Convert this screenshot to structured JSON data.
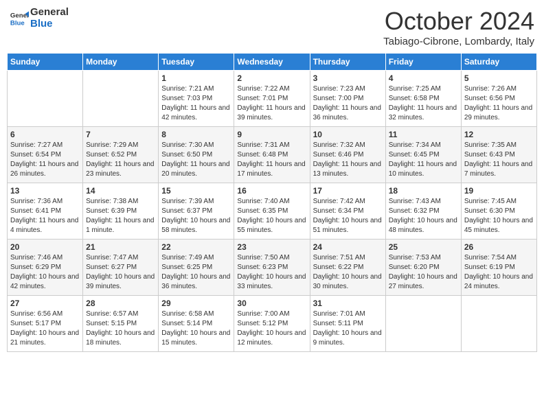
{
  "header": {
    "logo_line1": "General",
    "logo_line2": "Blue",
    "month": "October 2024",
    "location": "Tabiago-Cibrone, Lombardy, Italy"
  },
  "days_of_week": [
    "Sunday",
    "Monday",
    "Tuesday",
    "Wednesday",
    "Thursday",
    "Friday",
    "Saturday"
  ],
  "weeks": [
    [
      {
        "day": "",
        "info": ""
      },
      {
        "day": "",
        "info": ""
      },
      {
        "day": "1",
        "info": "Sunrise: 7:21 AM\nSunset: 7:03 PM\nDaylight: 11 hours and 42 minutes."
      },
      {
        "day": "2",
        "info": "Sunrise: 7:22 AM\nSunset: 7:01 PM\nDaylight: 11 hours and 39 minutes."
      },
      {
        "day": "3",
        "info": "Sunrise: 7:23 AM\nSunset: 7:00 PM\nDaylight: 11 hours and 36 minutes."
      },
      {
        "day": "4",
        "info": "Sunrise: 7:25 AM\nSunset: 6:58 PM\nDaylight: 11 hours and 32 minutes."
      },
      {
        "day": "5",
        "info": "Sunrise: 7:26 AM\nSunset: 6:56 PM\nDaylight: 11 hours and 29 minutes."
      }
    ],
    [
      {
        "day": "6",
        "info": "Sunrise: 7:27 AM\nSunset: 6:54 PM\nDaylight: 11 hours and 26 minutes."
      },
      {
        "day": "7",
        "info": "Sunrise: 7:29 AM\nSunset: 6:52 PM\nDaylight: 11 hours and 23 minutes."
      },
      {
        "day": "8",
        "info": "Sunrise: 7:30 AM\nSunset: 6:50 PM\nDaylight: 11 hours and 20 minutes."
      },
      {
        "day": "9",
        "info": "Sunrise: 7:31 AM\nSunset: 6:48 PM\nDaylight: 11 hours and 17 minutes."
      },
      {
        "day": "10",
        "info": "Sunrise: 7:32 AM\nSunset: 6:46 PM\nDaylight: 11 hours and 13 minutes."
      },
      {
        "day": "11",
        "info": "Sunrise: 7:34 AM\nSunset: 6:45 PM\nDaylight: 11 hours and 10 minutes."
      },
      {
        "day": "12",
        "info": "Sunrise: 7:35 AM\nSunset: 6:43 PM\nDaylight: 11 hours and 7 minutes."
      }
    ],
    [
      {
        "day": "13",
        "info": "Sunrise: 7:36 AM\nSunset: 6:41 PM\nDaylight: 11 hours and 4 minutes."
      },
      {
        "day": "14",
        "info": "Sunrise: 7:38 AM\nSunset: 6:39 PM\nDaylight: 11 hours and 1 minute."
      },
      {
        "day": "15",
        "info": "Sunrise: 7:39 AM\nSunset: 6:37 PM\nDaylight: 10 hours and 58 minutes."
      },
      {
        "day": "16",
        "info": "Sunrise: 7:40 AM\nSunset: 6:35 PM\nDaylight: 10 hours and 55 minutes."
      },
      {
        "day": "17",
        "info": "Sunrise: 7:42 AM\nSunset: 6:34 PM\nDaylight: 10 hours and 51 minutes."
      },
      {
        "day": "18",
        "info": "Sunrise: 7:43 AM\nSunset: 6:32 PM\nDaylight: 10 hours and 48 minutes."
      },
      {
        "day": "19",
        "info": "Sunrise: 7:45 AM\nSunset: 6:30 PM\nDaylight: 10 hours and 45 minutes."
      }
    ],
    [
      {
        "day": "20",
        "info": "Sunrise: 7:46 AM\nSunset: 6:29 PM\nDaylight: 10 hours and 42 minutes."
      },
      {
        "day": "21",
        "info": "Sunrise: 7:47 AM\nSunset: 6:27 PM\nDaylight: 10 hours and 39 minutes."
      },
      {
        "day": "22",
        "info": "Sunrise: 7:49 AM\nSunset: 6:25 PM\nDaylight: 10 hours and 36 minutes."
      },
      {
        "day": "23",
        "info": "Sunrise: 7:50 AM\nSunset: 6:23 PM\nDaylight: 10 hours and 33 minutes."
      },
      {
        "day": "24",
        "info": "Sunrise: 7:51 AM\nSunset: 6:22 PM\nDaylight: 10 hours and 30 minutes."
      },
      {
        "day": "25",
        "info": "Sunrise: 7:53 AM\nSunset: 6:20 PM\nDaylight: 10 hours and 27 minutes."
      },
      {
        "day": "26",
        "info": "Sunrise: 7:54 AM\nSunset: 6:19 PM\nDaylight: 10 hours and 24 minutes."
      }
    ],
    [
      {
        "day": "27",
        "info": "Sunrise: 6:56 AM\nSunset: 5:17 PM\nDaylight: 10 hours and 21 minutes."
      },
      {
        "day": "28",
        "info": "Sunrise: 6:57 AM\nSunset: 5:15 PM\nDaylight: 10 hours and 18 minutes."
      },
      {
        "day": "29",
        "info": "Sunrise: 6:58 AM\nSunset: 5:14 PM\nDaylight: 10 hours and 15 minutes."
      },
      {
        "day": "30",
        "info": "Sunrise: 7:00 AM\nSunset: 5:12 PM\nDaylight: 10 hours and 12 minutes."
      },
      {
        "day": "31",
        "info": "Sunrise: 7:01 AM\nSunset: 5:11 PM\nDaylight: 10 hours and 9 minutes."
      },
      {
        "day": "",
        "info": ""
      },
      {
        "day": "",
        "info": ""
      }
    ]
  ]
}
